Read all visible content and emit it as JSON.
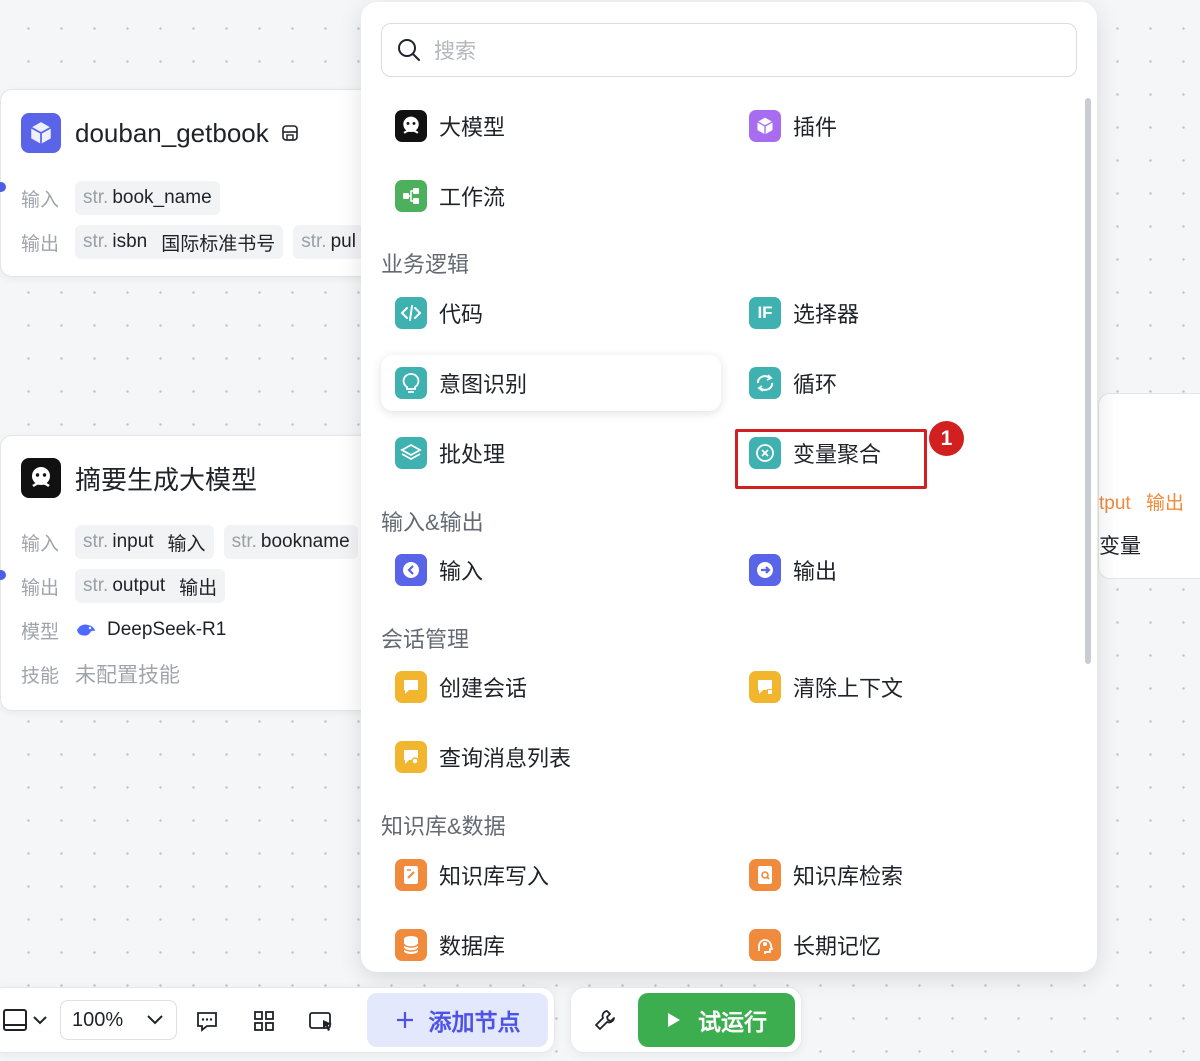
{
  "canvas": {
    "node1": {
      "title": "douban_getbook",
      "input_label": "输入",
      "output_label": "输出",
      "inputs": [
        {
          "type": "str.",
          "name": "book_name",
          "desc": ""
        }
      ],
      "outputs": [
        {
          "type": "str.",
          "name": "isbn",
          "desc": "国际标准书号"
        },
        {
          "type": "str.",
          "name": "pul",
          "desc": ""
        }
      ]
    },
    "node2": {
      "title": "摘要生成大模型",
      "input_label": "输入",
      "output_label": "输出",
      "model_label": "模型",
      "skill_label": "技能",
      "inputs": [
        {
          "type": "str.",
          "name": "input",
          "desc": "输入"
        },
        {
          "type": "str.",
          "name": "bookname",
          "desc": ""
        }
      ],
      "outputs": [
        {
          "type": "str.",
          "name": "output",
          "desc": "输出"
        }
      ],
      "model": "DeepSeek-R1",
      "skills": "未配置技能"
    },
    "right_node": {
      "output_text": "tput",
      "output_desc": "输出",
      "var_text": "变量"
    }
  },
  "menu": {
    "search_placeholder": "搜索",
    "top_items": [
      "大模型",
      "插件",
      "工作流"
    ],
    "sections": [
      {
        "title": "业务逻辑",
        "items": [
          "代码",
          "选择器",
          "意图识别",
          "循环",
          "批处理",
          "变量聚合"
        ]
      },
      {
        "title": "输入&输出",
        "items": [
          "输入",
          "输出"
        ]
      },
      {
        "title": "会话管理",
        "items": [
          "创建会话",
          "清除上下文",
          "查询消息列表"
        ]
      },
      {
        "title": "知识库&数据",
        "items": [
          "知识库写入",
          "知识库检索",
          "数据库",
          "长期记忆"
        ]
      }
    ],
    "annotation_badge": "1"
  },
  "toolbar": {
    "zoom": "100%",
    "add_node_label": "添加节点",
    "run_label": "试运行"
  },
  "colors": {
    "accent": "#4d53e8",
    "run_green": "#3cae4f",
    "highlight_red": "#d21f1f",
    "teal_icon": "#3fb1b0",
    "purple_icon": "#a76cf0",
    "green_icon": "#4cb05c",
    "indigo_icon": "#5a64e8",
    "yellow_icon": "#f2b62e",
    "orange_icon": "#f08a3c"
  }
}
